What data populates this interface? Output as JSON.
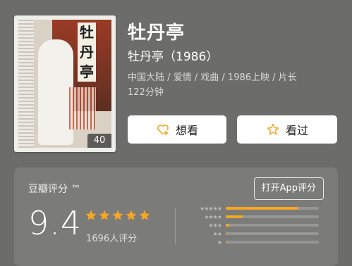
{
  "poster": {
    "title": "牡丹亭",
    "photo_count": "40"
  },
  "movie": {
    "title": "牡丹亭",
    "subtitle": "牡丹亭（1986）",
    "meta_line1": "中国大陆 / 爱情 / 戏曲 / 1986上映 / 片长",
    "meta_line2": "122分钟"
  },
  "actions": {
    "want_label": "想看",
    "seen_label": "看过"
  },
  "rating": {
    "label": "豆瓣评分 ™",
    "app_button": "打开App评分",
    "score": "9.4",
    "count": "1696人评分",
    "stars_filled": 5,
    "distribution": [
      {
        "stars": "★★★★★",
        "fraction": 0.78
      },
      {
        "stars": "★★★★",
        "fraction": 0.18
      },
      {
        "stars": "★★★",
        "fraction": 0.04
      },
      {
        "stars": "★★",
        "fraction": 0.01
      },
      {
        "stars": "★",
        "fraction": 0.01
      }
    ]
  },
  "colors": {
    "background": "#6c6c6a",
    "star": "#f5a623",
    "panel": "#7b7b79"
  }
}
